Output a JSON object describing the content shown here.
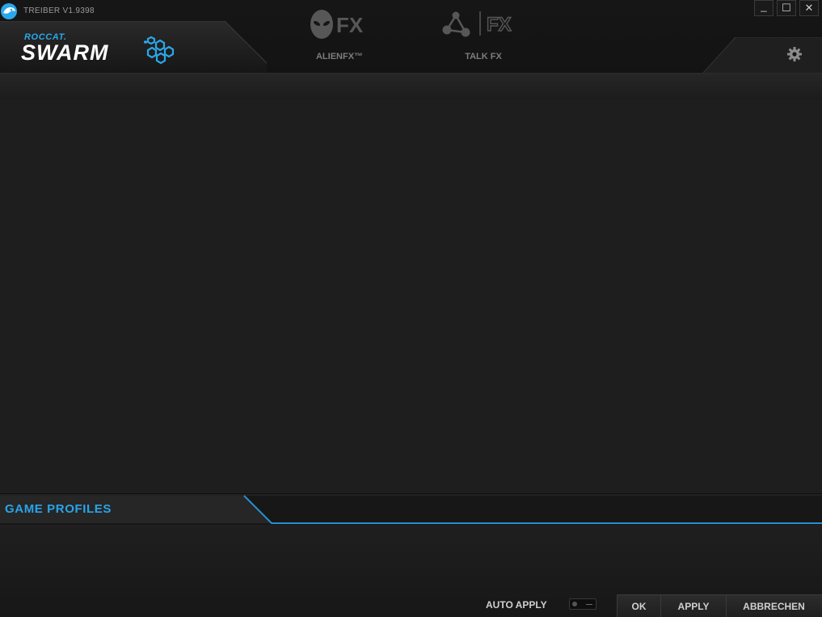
{
  "window": {
    "title": "TREIBER V1.9398",
    "minimize_glyph": "_",
    "maximize_glyph": "☐",
    "close_glyph": "✕"
  },
  "brand": {
    "small": "ROCCAT.",
    "big": "SWARM",
    "accent_color": "#2aa7ea"
  },
  "nav": {
    "tabs": [
      {
        "label": "ALIENFX™",
        "icon": "alienfx-icon"
      },
      {
        "label": "TALK FX",
        "icon": "talkfx-icon"
      }
    ]
  },
  "settings": {
    "icon": "gear-icon"
  },
  "game_profiles": {
    "title": "GAME PROFILES"
  },
  "footer": {
    "auto_apply_label": "AUTO APPLY",
    "auto_apply_on": false,
    "ok_label": "OK",
    "apply_label": "APPLY",
    "cancel_label": "ABBRECHEN"
  }
}
